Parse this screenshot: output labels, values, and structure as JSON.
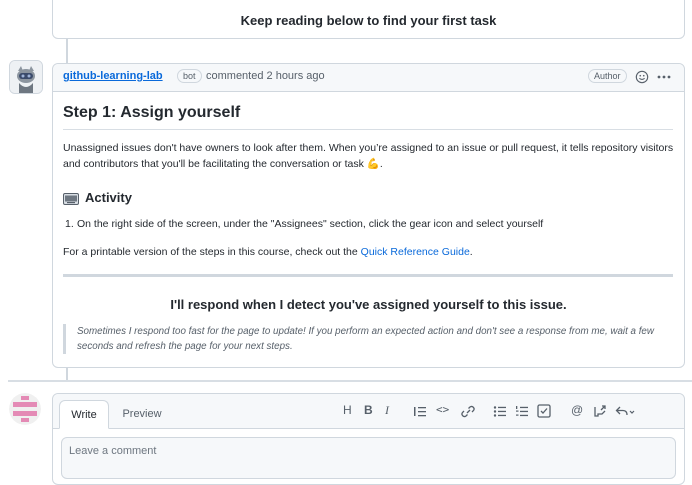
{
  "top_banner": {
    "text": "Keep reading below to find your first task"
  },
  "comment": {
    "author": "github-learning-lab",
    "bot_badge": "bot",
    "meta": "commented 2 hours ago",
    "author_badge": "Author",
    "icons": [
      "smiley-icon",
      "kebab-horizontal-icon"
    ],
    "step_title": "Step 1: Assign yourself",
    "intro_text": "Unassigned issues don't have owners to look after them. When you’re assigned to an issue or pull request, it tells repository visitors and contributors that you'll be facilitating the conversation or task",
    "intro_emoji": "💪",
    "intro_end": ".",
    "activity_icon": "keyboard-icon",
    "activity_heading": "Activity",
    "activity_items": [
      "On the right side of the screen, under the \"Assignees\" section, click the gear icon and select yourself"
    ],
    "reference_prefix": "For a printable version of the steps in this course, check out the ",
    "reference_link": "Quick Reference Guide",
    "reference_suffix": ".",
    "respond_heading": "I'll respond when I detect you've assigned yourself to this issue.",
    "note": "Sometimes I respond too fast for the page to update! If you perform an expected action and don't see a response from me, wait a few seconds and refresh the page for your next steps."
  },
  "editor": {
    "tabs": [
      "Write",
      "Preview"
    ],
    "active_tab": "Write",
    "toolbar": {
      "heading": "H",
      "bold": "B",
      "italic": "I",
      "quote": "quote-icon",
      "code": "<>",
      "link": "link-icon",
      "unordered_list": "list-unordered-icon",
      "ordered_list": "list-ordered-icon",
      "tasklist": "tasklist-icon",
      "mention": "@",
      "reference": "cross-reference-icon",
      "reply": "reply-icon"
    },
    "placeholder": "Leave a comment"
  }
}
